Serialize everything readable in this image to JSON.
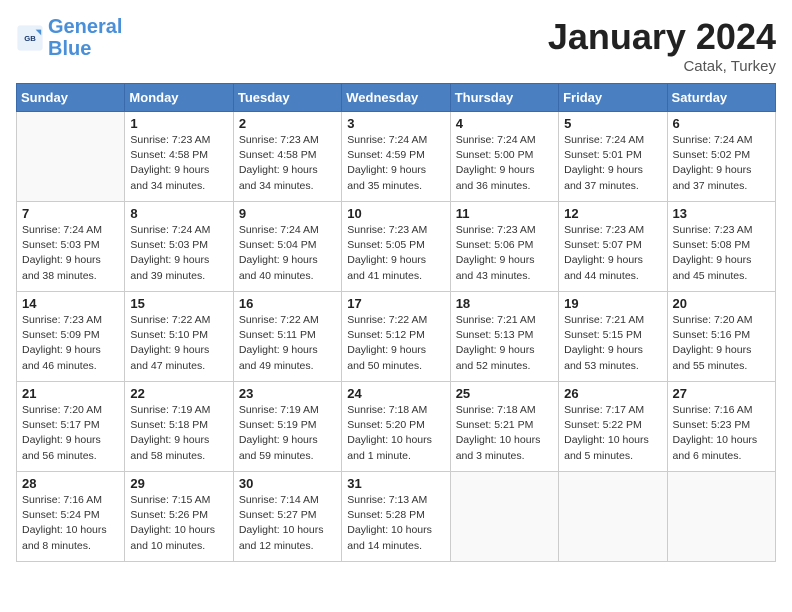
{
  "logo": {
    "line1": "General",
    "line2": "Blue"
  },
  "title": "January 2024",
  "location": "Catak, Turkey",
  "days_of_week": [
    "Sunday",
    "Monday",
    "Tuesday",
    "Wednesday",
    "Thursday",
    "Friday",
    "Saturday"
  ],
  "weeks": [
    [
      {
        "num": "",
        "info": ""
      },
      {
        "num": "1",
        "info": "Sunrise: 7:23 AM\nSunset: 4:58 PM\nDaylight: 9 hours\nand 34 minutes."
      },
      {
        "num": "2",
        "info": "Sunrise: 7:23 AM\nSunset: 4:58 PM\nDaylight: 9 hours\nand 34 minutes."
      },
      {
        "num": "3",
        "info": "Sunrise: 7:24 AM\nSunset: 4:59 PM\nDaylight: 9 hours\nand 35 minutes."
      },
      {
        "num": "4",
        "info": "Sunrise: 7:24 AM\nSunset: 5:00 PM\nDaylight: 9 hours\nand 36 minutes."
      },
      {
        "num": "5",
        "info": "Sunrise: 7:24 AM\nSunset: 5:01 PM\nDaylight: 9 hours\nand 37 minutes."
      },
      {
        "num": "6",
        "info": "Sunrise: 7:24 AM\nSunset: 5:02 PM\nDaylight: 9 hours\nand 37 minutes."
      }
    ],
    [
      {
        "num": "7",
        "info": "Sunrise: 7:24 AM\nSunset: 5:03 PM\nDaylight: 9 hours\nand 38 minutes."
      },
      {
        "num": "8",
        "info": "Sunrise: 7:24 AM\nSunset: 5:03 PM\nDaylight: 9 hours\nand 39 minutes."
      },
      {
        "num": "9",
        "info": "Sunrise: 7:24 AM\nSunset: 5:04 PM\nDaylight: 9 hours\nand 40 minutes."
      },
      {
        "num": "10",
        "info": "Sunrise: 7:23 AM\nSunset: 5:05 PM\nDaylight: 9 hours\nand 41 minutes."
      },
      {
        "num": "11",
        "info": "Sunrise: 7:23 AM\nSunset: 5:06 PM\nDaylight: 9 hours\nand 43 minutes."
      },
      {
        "num": "12",
        "info": "Sunrise: 7:23 AM\nSunset: 5:07 PM\nDaylight: 9 hours\nand 44 minutes."
      },
      {
        "num": "13",
        "info": "Sunrise: 7:23 AM\nSunset: 5:08 PM\nDaylight: 9 hours\nand 45 minutes."
      }
    ],
    [
      {
        "num": "14",
        "info": "Sunrise: 7:23 AM\nSunset: 5:09 PM\nDaylight: 9 hours\nand 46 minutes."
      },
      {
        "num": "15",
        "info": "Sunrise: 7:22 AM\nSunset: 5:10 PM\nDaylight: 9 hours\nand 47 minutes."
      },
      {
        "num": "16",
        "info": "Sunrise: 7:22 AM\nSunset: 5:11 PM\nDaylight: 9 hours\nand 49 minutes."
      },
      {
        "num": "17",
        "info": "Sunrise: 7:22 AM\nSunset: 5:12 PM\nDaylight: 9 hours\nand 50 minutes."
      },
      {
        "num": "18",
        "info": "Sunrise: 7:21 AM\nSunset: 5:13 PM\nDaylight: 9 hours\nand 52 minutes."
      },
      {
        "num": "19",
        "info": "Sunrise: 7:21 AM\nSunset: 5:15 PM\nDaylight: 9 hours\nand 53 minutes."
      },
      {
        "num": "20",
        "info": "Sunrise: 7:20 AM\nSunset: 5:16 PM\nDaylight: 9 hours\nand 55 minutes."
      }
    ],
    [
      {
        "num": "21",
        "info": "Sunrise: 7:20 AM\nSunset: 5:17 PM\nDaylight: 9 hours\nand 56 minutes."
      },
      {
        "num": "22",
        "info": "Sunrise: 7:19 AM\nSunset: 5:18 PM\nDaylight: 9 hours\nand 58 minutes."
      },
      {
        "num": "23",
        "info": "Sunrise: 7:19 AM\nSunset: 5:19 PM\nDaylight: 9 hours\nand 59 minutes."
      },
      {
        "num": "24",
        "info": "Sunrise: 7:18 AM\nSunset: 5:20 PM\nDaylight: 10 hours\nand 1 minute."
      },
      {
        "num": "25",
        "info": "Sunrise: 7:18 AM\nSunset: 5:21 PM\nDaylight: 10 hours\nand 3 minutes."
      },
      {
        "num": "26",
        "info": "Sunrise: 7:17 AM\nSunset: 5:22 PM\nDaylight: 10 hours\nand 5 minutes."
      },
      {
        "num": "27",
        "info": "Sunrise: 7:16 AM\nSunset: 5:23 PM\nDaylight: 10 hours\nand 6 minutes."
      }
    ],
    [
      {
        "num": "28",
        "info": "Sunrise: 7:16 AM\nSunset: 5:24 PM\nDaylight: 10 hours\nand 8 minutes."
      },
      {
        "num": "29",
        "info": "Sunrise: 7:15 AM\nSunset: 5:26 PM\nDaylight: 10 hours\nand 10 minutes."
      },
      {
        "num": "30",
        "info": "Sunrise: 7:14 AM\nSunset: 5:27 PM\nDaylight: 10 hours\nand 12 minutes."
      },
      {
        "num": "31",
        "info": "Sunrise: 7:13 AM\nSunset: 5:28 PM\nDaylight: 10 hours\nand 14 minutes."
      },
      {
        "num": "",
        "info": ""
      },
      {
        "num": "",
        "info": ""
      },
      {
        "num": "",
        "info": ""
      }
    ]
  ]
}
